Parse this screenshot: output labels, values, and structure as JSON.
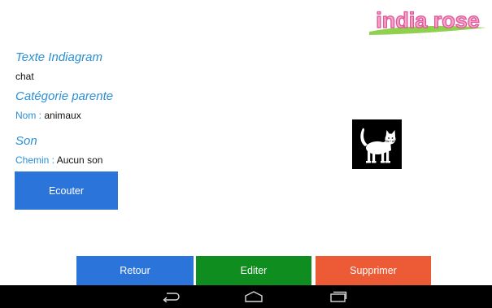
{
  "logo": {
    "text": "india rose",
    "colors": {
      "text_fill": "#f4a6c6",
      "text_outline": "#e0549a",
      "swoosh": "#8fd14f"
    }
  },
  "indiagram_text": {
    "title": "Texte Indiagram",
    "value": "chat"
  },
  "parent_category": {
    "title": "Catégorie parente",
    "name_label": "Nom :",
    "name_value": "animaux"
  },
  "sound": {
    "title": "Son",
    "path_label": "Chemin :",
    "path_value": "Aucun son",
    "listen_button": "Ecouter"
  },
  "image": {
    "subject": "cat",
    "icon": "white-cat-on-black"
  },
  "actions": {
    "back": "Retour",
    "edit": "Editer",
    "delete": "Supprimer"
  },
  "colors": {
    "title_blue": "#2a8fd6",
    "button_blue": "#2b74d9",
    "button_green": "#0f8d1f",
    "button_orange": "#ec5a36"
  },
  "navigation_bar": {
    "icons": [
      "back-icon",
      "home-icon",
      "recent-apps-icon"
    ]
  }
}
